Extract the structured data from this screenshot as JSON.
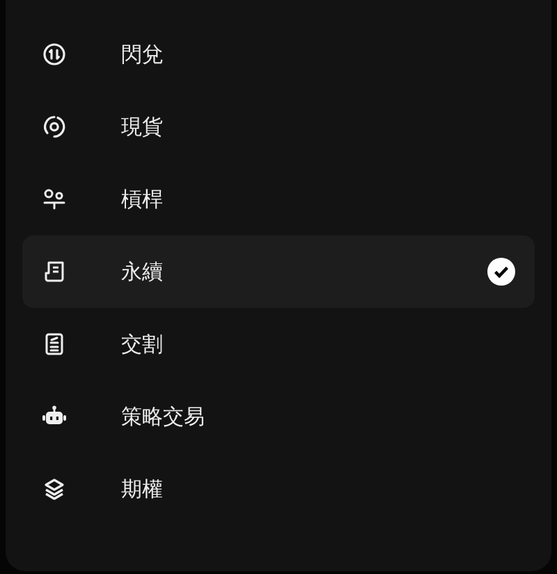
{
  "menu": {
    "items": [
      {
        "kind": "swap",
        "label": "閃兌",
        "selected": false
      },
      {
        "kind": "spot",
        "label": "現貨",
        "selected": false
      },
      {
        "kind": "leverage",
        "label": "槓桿",
        "selected": false
      },
      {
        "kind": "perpetual",
        "label": "永續",
        "selected": true
      },
      {
        "kind": "delivery",
        "label": "交割",
        "selected": false
      },
      {
        "kind": "bot",
        "label": "策略交易",
        "selected": false
      },
      {
        "kind": "options",
        "label": "期權",
        "selected": false
      }
    ]
  }
}
